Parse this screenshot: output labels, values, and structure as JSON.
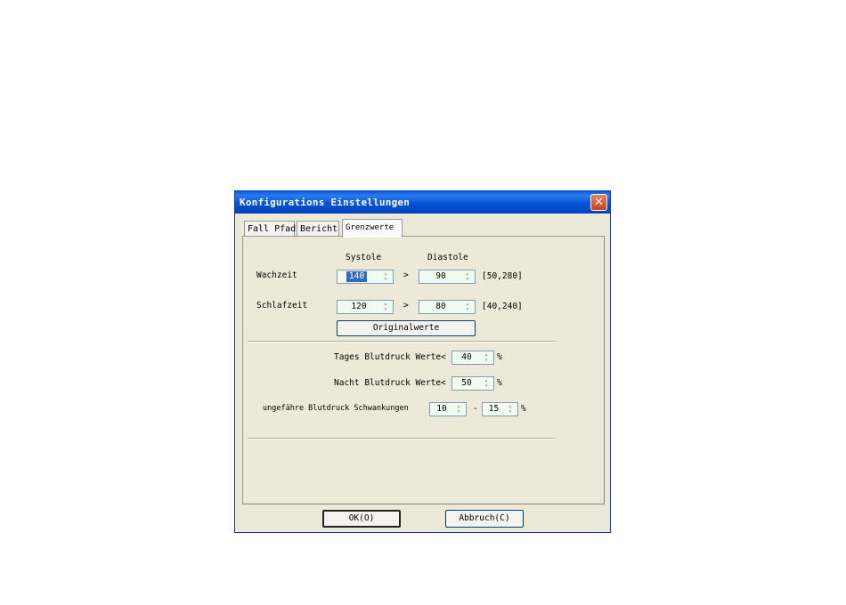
{
  "dialog": {
    "title": "Konfigurations Einstellungen",
    "close_symbol": "✕",
    "tabs": [
      "Fall Pfad",
      "Bericht",
      "Grenzwerte"
    ],
    "active_tab": "Grenzwerte"
  },
  "limits": {
    "systole_header": "Systole",
    "diastole_header": "Diastole",
    "wake_label": "Wachzeit",
    "wake_systole": "140",
    "wake_diastole": "90",
    "wake_range": "[50,280]",
    "sleep_label": "Schlafzeit",
    "sleep_systole": "120",
    "sleep_diastole": "80",
    "sleep_range": "[40,240]",
    "gt_symbol": ">",
    "reset_button": "Originalwerte"
  },
  "percentages": {
    "day_label": "Tages Blutdruck Werte<",
    "day_value": "40",
    "night_label": "Nacht Blutdruck Werte<",
    "night_value": "50",
    "fluct_label": "ungefähre Blutdruck Schwankungen",
    "fluct_min": "10",
    "fluct_sep": "-",
    "fluct_max": "15",
    "percent": "%"
  },
  "buttons": {
    "ok": "OK(O)",
    "cancel": "Abbruch(C)"
  },
  "colors": {
    "titlebar": "#0553d6",
    "dialog_bg": "#ece9d8",
    "close": "#c9431a",
    "spin_bg": "#f0fcee",
    "selection": "#316ac5"
  },
  "icons": {
    "close": "close-icon",
    "spin": "spin-arrows-icon"
  }
}
